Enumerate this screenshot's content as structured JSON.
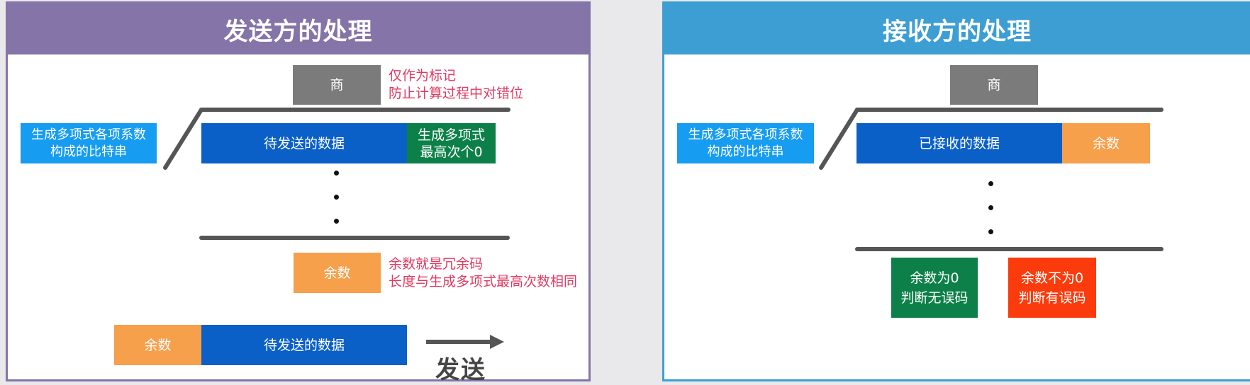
{
  "sender": {
    "title": "发送方的处理",
    "quotient": "商",
    "quotient_note": [
      "仅作为标记",
      "防止计算过程中对错位"
    ],
    "divisor": [
      "生成多项式各项系数",
      "构成的比特串"
    ],
    "data": "待发送的数据",
    "padding": [
      "生成多项式",
      "最高次个0"
    ],
    "remainder": "余数",
    "remainder_note": [
      "余数就是冗余码",
      "长度与生成多项式最高次数相同"
    ],
    "frame_remainder": "余数",
    "frame_data": "待发送的数据",
    "send_label": "发送"
  },
  "receiver": {
    "title": "接收方的处理",
    "quotient": "商",
    "divisor": [
      "生成多项式各项系数",
      "构成的比特串"
    ],
    "data": "已接收的数据",
    "remainder": "余数",
    "result_ok": [
      "余数为0",
      "判断无误码"
    ],
    "result_error": [
      "余数不为0",
      "判断有误码"
    ]
  },
  "colors": {
    "sender_header": "#8474a8",
    "receiver_header": "#3d9ed3",
    "data_blue": "#0a60c6",
    "remainder_orange": "#f6a04c",
    "ok_green": "#0c8048",
    "error_red": "#fb3b0c",
    "note_red": "#e03a62"
  }
}
